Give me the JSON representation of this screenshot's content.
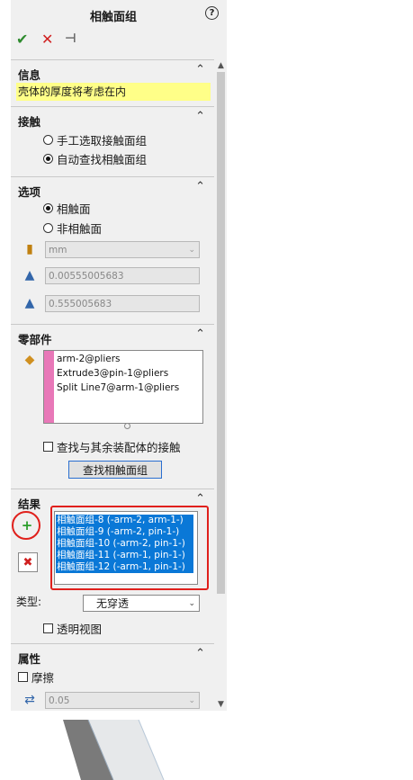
{
  "title": "相触面组",
  "toolbar": {
    "ok_icon": "check-icon",
    "cancel_icon": "close-icon",
    "pin_icon": "pushpin-icon"
  },
  "sections": {
    "info": {
      "header": "信息",
      "message": "壳体的厚度将考虑在内"
    },
    "contact": {
      "header": "接触",
      "options": [
        "手工选取接触面组",
        "自动查找相触面组"
      ],
      "selected": 1
    },
    "options": {
      "header": "选项",
      "choices": [
        "相触面",
        "非相触面"
      ],
      "selected": 0,
      "unit": "mm",
      "value1": "0.00555005683",
      "value2": "0.555005683"
    },
    "components": {
      "header": "零部件",
      "items": [
        "arm-2@pliers",
        "Extrude3@pin-1@pliers",
        "Split Line7@arm-1@pliers"
      ],
      "checkbox_label": "查找与其余装配体的接触",
      "button_label": "查找相触面组"
    },
    "results": {
      "header": "结果",
      "items": [
        "相触面组-8 (-arm-2, arm-1-)",
        "相触面组-9 (-arm-2, pin-1-)",
        "相触面组-10 (-arm-2, pin-1-)",
        "相触面组-11 (-arm-1, pin-1-)",
        "相触面组-12 (-arm-1, pin-1-)"
      ],
      "type_label": "类型:",
      "type_value": "无穿透",
      "transparent_label": "透明视图"
    },
    "properties": {
      "header": "属性",
      "friction_label": "摩擦",
      "friction_value": "0.05"
    }
  },
  "colors": {
    "info_bg": "#ffff88",
    "selection": "#0a78d7",
    "highlight": "#e0201c",
    "pink_marker": "#e878b8"
  }
}
